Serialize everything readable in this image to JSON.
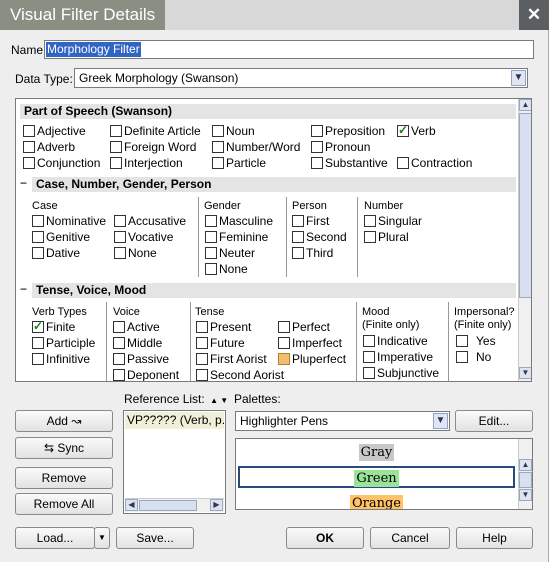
{
  "window": {
    "title": "Visual Filter Details",
    "close_glyph": "✕",
    "title_bg": "#8a8f84",
    "close_bg": "#5c5f62"
  },
  "name_field": {
    "label": "Name:",
    "value": "Morphology Filter"
  },
  "data_type": {
    "label": "Data Type:",
    "value": "Greek Morphology (Swanson)"
  },
  "part_of_speech": {
    "heading": "Part of Speech (Swanson)",
    "items": [
      {
        "label": "Adjective",
        "checked": false
      },
      {
        "label": "Definite Article",
        "checked": false
      },
      {
        "label": "Noun",
        "checked": false
      },
      {
        "label": "Preposition",
        "checked": false
      },
      {
        "label": "Verb",
        "checked": true
      },
      {
        "label": "Adverb",
        "checked": false
      },
      {
        "label": "Foreign Word",
        "checked": false
      },
      {
        "label": "Number/Word",
        "checked": false
      },
      {
        "label": "Pronoun",
        "checked": false
      },
      {
        "label": "Conjunction",
        "checked": false
      },
      {
        "label": "Interjection",
        "checked": false
      },
      {
        "label": "Particle",
        "checked": false
      },
      {
        "label": "Substantive",
        "checked": false
      },
      {
        "label": "Contraction",
        "checked": false
      }
    ]
  },
  "case_section": {
    "collapse_glyph": "−",
    "heading": "Case, Number, Gender, Person",
    "case_title": "Case",
    "case_items": [
      "Nominative",
      "Accusative",
      "Genitive",
      "Vocative",
      "Dative",
      "None"
    ],
    "gender_title": "Gender",
    "gender_items": [
      "Masculine",
      "Feminine",
      "Neuter",
      "None"
    ],
    "person_title": "Person",
    "person_items": [
      "First",
      "Second",
      "Third"
    ],
    "number_title": "Number",
    "number_items": [
      "Singular",
      "Plural"
    ]
  },
  "tense_section": {
    "collapse_glyph": "−",
    "heading": "Tense, Voice, Mood",
    "verb_types_title": "Verb Types",
    "verb_types": [
      {
        "label": "Finite",
        "checked": true
      },
      {
        "label": "Participle",
        "checked": false
      },
      {
        "label": "Infinitive",
        "checked": false
      }
    ],
    "voice_title": "Voice",
    "voice_items": [
      "Active",
      "Middle",
      "Passive",
      "Deponent"
    ],
    "tense_title": "Tense",
    "tense_items": [
      "Present",
      "Perfect",
      "Future",
      "Imperfect",
      "First Aorist",
      "Pluperfect",
      "Second Aorist"
    ],
    "mood_title": "Mood",
    "mood_subtitle": "(Finite only)",
    "mood_items": [
      "Indicative",
      "Imperative",
      "Subjunctive"
    ],
    "impersonal_title": "Impersonal?",
    "impersonal_subtitle": "(Finite only)",
    "impersonal_items": [
      "Yes",
      "No"
    ]
  },
  "reference_list": {
    "label": "Reference List:",
    "sort_glyphs": "▲ ▼",
    "items": [
      "VP????? (Verb, p..."
    ]
  },
  "palettes": {
    "label": "Palettes:",
    "selected": "Highlighter Pens",
    "items": [
      {
        "label": "Gray",
        "color": "#c8c8c8"
      },
      {
        "label": "Green",
        "color": "#9be39b"
      },
      {
        "label": "Orange",
        "color": "#ffc266"
      }
    ]
  },
  "buttons": {
    "add": "Add",
    "sync": "Sync",
    "remove": "Remove",
    "remove_all": "Remove All",
    "load": "Load...",
    "save": "Save...",
    "edit": "Edit...",
    "ok": "OK",
    "cancel": "Cancel",
    "help": "Help"
  }
}
